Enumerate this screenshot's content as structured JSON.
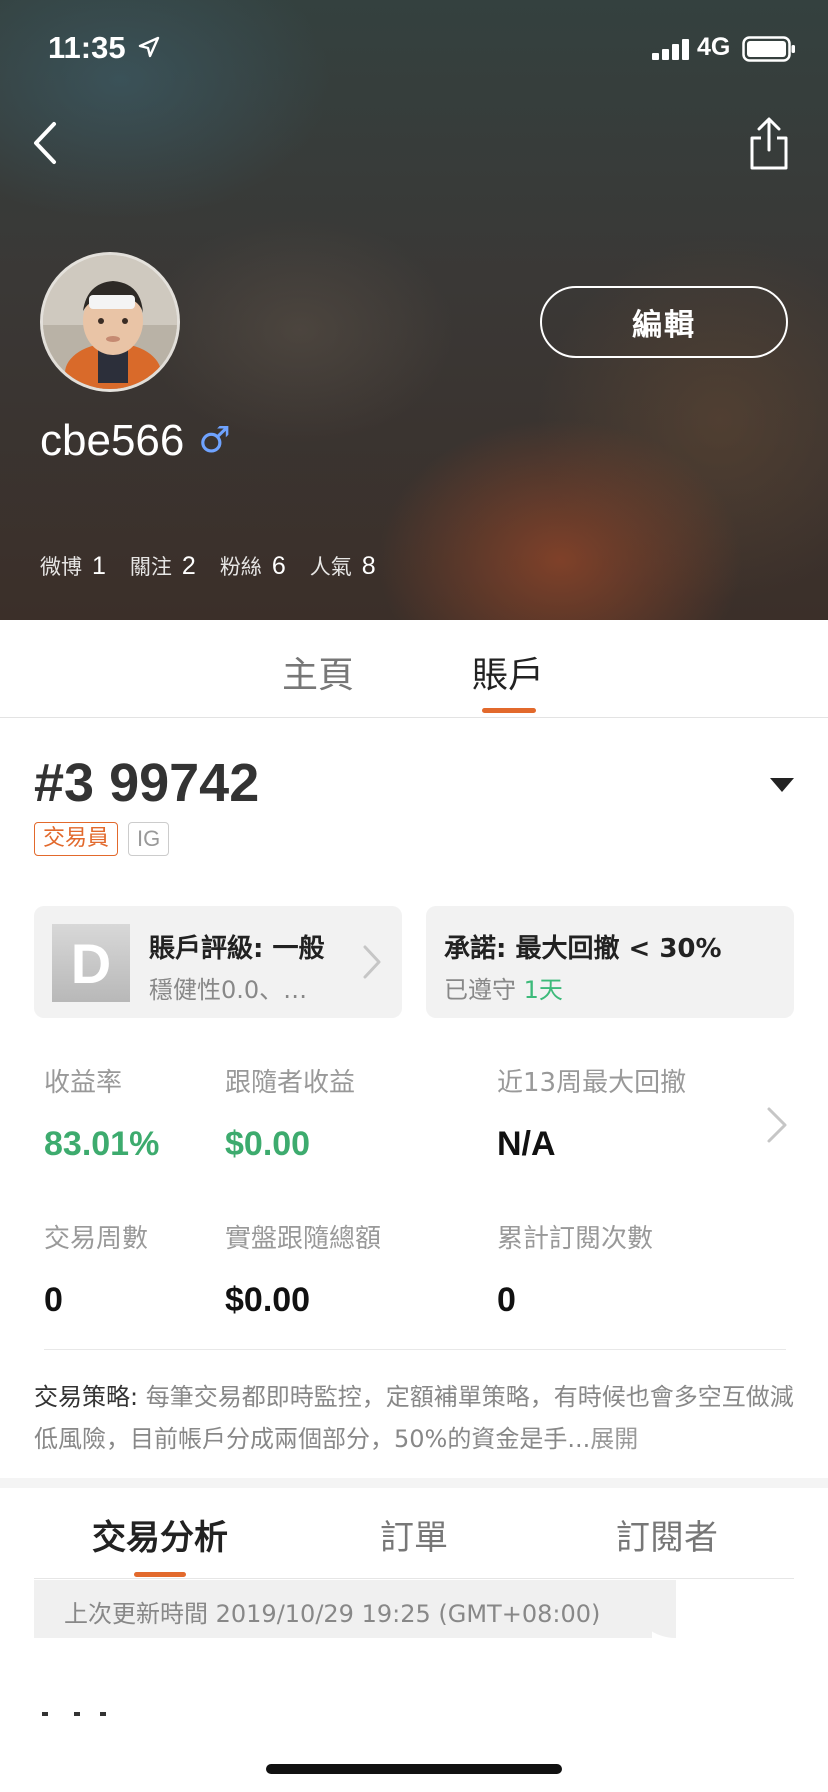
{
  "status_bar": {
    "time": "11:35",
    "network": "4G"
  },
  "profile": {
    "edit_label": "編輯",
    "username": "cbe566",
    "gender_symbol": "♂",
    "stats": [
      {
        "label": "微博",
        "value": "1"
      },
      {
        "label": "關注",
        "value": "2"
      },
      {
        "label": "粉絲",
        "value": "6"
      },
      {
        "label": "人氣",
        "value": "8"
      }
    ]
  },
  "profile_tabs": {
    "home": "主頁",
    "account": "賬戶",
    "active": "account"
  },
  "account": {
    "id": "#3 99742",
    "badges": {
      "trader": "交易員",
      "broker": "IG"
    },
    "rating": {
      "grade": "D",
      "title": "賬戶評級: 一般",
      "subtitle": "穩健性0.0、…"
    },
    "promise": {
      "title": "承諾: 最大回撤 < 30%",
      "status_prefix": "已遵守 ",
      "days": "1天"
    },
    "metrics": [
      {
        "label": "收益率",
        "value": "83.01%"
      },
      {
        "label": "跟隨者收益",
        "value": "$0.00"
      },
      {
        "label": "近13周最大回撤",
        "value": "N/A"
      },
      {
        "label": "交易周數",
        "value": "0"
      },
      {
        "label": "實盤跟隨總額",
        "value": "$0.00"
      },
      {
        "label": "累計訂閱次數",
        "value": "0"
      }
    ],
    "strategy": {
      "label": "交易策略:",
      "text": " 每筆交易都即時監控，定額補單策略，有時候也會多空互做減低風險，目前帳戶分成兩個部分，50%的資金是手...",
      "expand": "展開"
    }
  },
  "analysis_tabs": {
    "analysis": "交易分析",
    "orders": "訂單",
    "subscribers": "訂閱者",
    "active": "analysis"
  },
  "update_time": "上次更新時間 2019/10/29 19:25 (GMT+08:00)",
  "colors": {
    "accent": "#e2692c",
    "positive": "#3dab6e",
    "gender": "#6fa3ff"
  }
}
